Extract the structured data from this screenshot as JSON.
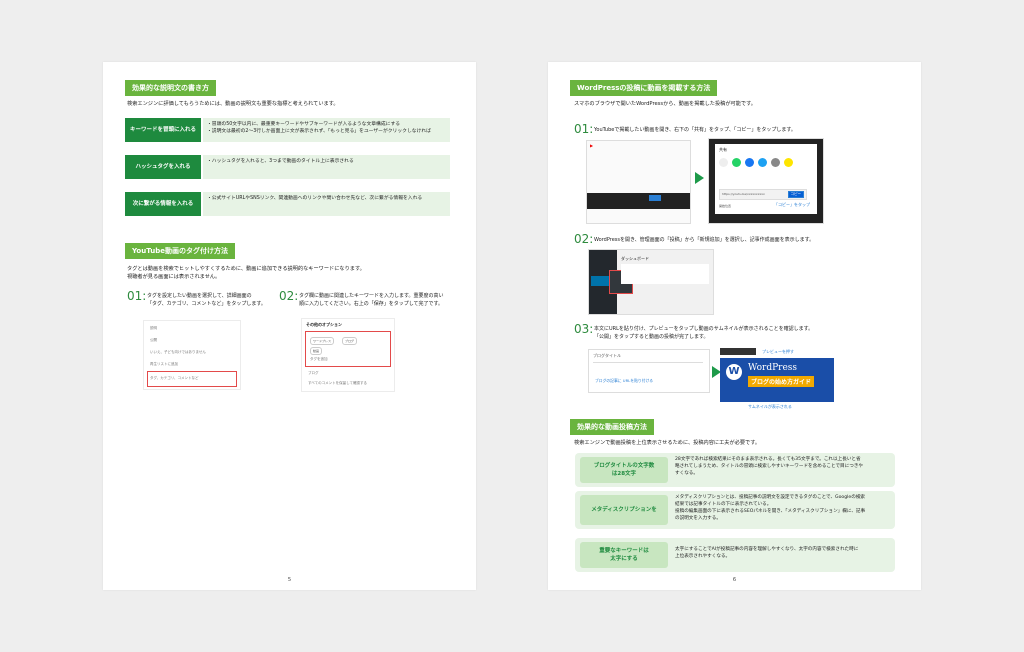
{
  "left_page": {
    "section1_title": "効果的な説明文の書き方",
    "section1_intro": "検索エンジンに評価してもらうためには、動画の説明文も重要な指標と考えられています。",
    "keys": [
      {
        "label": "キーワードを冒頭に入れる",
        "lines": [
          "・冒頭の50文字以内に、最重要キーワードやサブキーワードが入るような文章構成にする",
          "・説明文は最初の2〜3行しか画面上に文が表示されず、「もっと見る」をユーザーがクリックしなければ"
        ]
      },
      {
        "label": "ハッシュタグを入れる",
        "lines": [
          "・ハッシュタグを入れると、3つまで動画のタイトル上に表示される"
        ]
      },
      {
        "label": "次に繋がる情報を入れる",
        "lines": [
          "・公式サイトURLやSNSリンク、関連動画へのリンクや問い合わせ先など、次に繋がる情報を入れる"
        ]
      }
    ],
    "section2_title": "YouTube動画のタグ付け方法",
    "section2_intro1": "タグとは動画を検索でヒットしやすくするために、動画に追加できる説明的なキーワードになります。",
    "section2_intro2": "視聴者が見る画面には表示されません。",
    "step1_num": "01:",
    "step1_text1": "タグを設定したい動画を選択して、詳細画面の",
    "step1_text2": "「タグ、カテゴリ、コメントなど」をタップします。",
    "step2_num": "02:",
    "step2_text1": "タグ欄に動画に関連したキーワードを入力します。重要度の高い",
    "step2_text2": "順に入力してください。右上の「保存」をタップして完了です。",
    "phone1_rows": [
      "説明",
      "公開",
      "いいえ、子ども向けではありません",
      "再生リストに追加",
      "タグ、カテゴリ、コメントなど"
    ],
    "phone2_title": "その他のオプション",
    "phone2_chips": [
      "ワードプレス",
      "ブログ",
      "動画"
    ],
    "phone2_chip_note": "タグを追加",
    "phone2_rows": [
      "ブログ",
      "すべてのコメントを保留して確認する"
    ],
    "page_number": "5"
  },
  "right_page": {
    "section1_title": "WordPressの投稿に動画を掲載する方法",
    "section1_intro": "スマホのブラウザで開いたWordPressから、動画を掲載した投稿が可能です。",
    "s1_num": "01:",
    "s1_text": "YouTubeで掲載したい動画を開き、右下の「共有」をタップ、「コピー」をタップします。",
    "share_label": "共有",
    "share_icons": [
      "埋め込む",
      "WhatsApp",
      "Facebook",
      "Twitter",
      "メール",
      "KakaoTalk"
    ],
    "share_url": "https://youtu.be/xxxxxxxxxx",
    "copy_btn": "コピー",
    "copy_note": "「コピー」をタップ",
    "start_label": "開始位置",
    "s2_num": "02:",
    "s2_text": "WordPressを開き、管理画面の「投稿」から「新規追加」を選択し、記事作成画面を表示します。",
    "dash_title": "ダッシュボード",
    "s3_num": "03:",
    "s3_text1": "本文にURLを貼り付け、プレビューをタップし動画のサムネイルが表示されることを確認します。",
    "s3_text2": "「公開」をタップすると動画の投稿が完了します。",
    "editor_title": "ブログタイトル",
    "paste_note": "ブログの記事に URLを貼り付ける",
    "preview_note": "プレビューを押す",
    "thumb_title1": "WordPress",
    "thumb_title2": "ブログの始め方ガイド",
    "thumb_note": "サムネイルが表示される",
    "section2_title": "効果的な動画投稿方法",
    "section2_intro": "検索エンジンで動画投稿を上位表示させるために、投稿内容に工夫が必要です。",
    "effects": [
      {
        "label": "ブログタイトルの文字数\nは28文字",
        "lines": [
          "28文字であれば検索結果にそのまま表示される。長くても35文字まで。これ以上長いと省",
          "略されてしまうため、タイトルの冒頭に検索しやすいキーワードを含めることで目につきや",
          "すくなる。"
        ]
      },
      {
        "label": "メタディスクリプションを",
        "lines": [
          "メタディスクリプションとは、投稿記事の説明文を設定できるタグのことで、Googleの検索",
          "結果では記事タイトルの下に表示されている。",
          "投稿の編集画面の下に表示されるSEOパネルを開き、「メタディスクリプション」欄に、記事",
          "の説明文を入力する。"
        ]
      },
      {
        "label": "重要なキーワードは\n太字にする",
        "lines": [
          "太字にすることでAIが投稿記事の内容を理解しやすくなり、太字の内容で検索された時に",
          "上位表示されやすくなる。"
        ]
      }
    ],
    "page_number": "6"
  }
}
